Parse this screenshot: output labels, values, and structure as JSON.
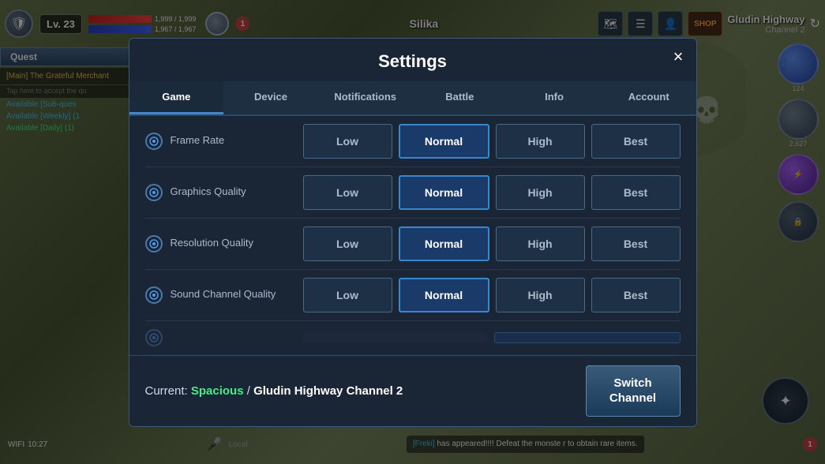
{
  "game": {
    "level": "Lv. 23",
    "hp": "1,999 / 1,999",
    "mp": "1,967 / 1,967",
    "player_name": "Silika",
    "location": "Gludin Highway",
    "channel": "Channel 2",
    "shield_icon": "🛡",
    "orbs": [
      {
        "label": "124",
        "type": "blue"
      },
      {
        "label": "2,627",
        "type": "gray"
      },
      {
        "label": "",
        "type": "purple"
      },
      {
        "label": "",
        "type": "dark"
      }
    ]
  },
  "quest_panel": {
    "quest_btn_label": "Quest",
    "items": [
      {
        "text": "[Main] The Grateful Merchant",
        "color": "gold"
      },
      {
        "text": "Tap here to accept the qu",
        "color": "gray"
      },
      {
        "text": "Available [Sub-ques",
        "color": "cyan"
      },
      {
        "text": "Available [Weekly] (1",
        "color": "cyan"
      },
      {
        "text": "Available [Daily] (1)",
        "color": "green"
      }
    ]
  },
  "bottom": {
    "wifi_label": "WIFI",
    "time": "10:27",
    "chat_speaker": "[Freki]",
    "chat_msg": " has appeared!!!! Defeat the monste\nr to obtain rare items.",
    "local_label": "Local",
    "badge_num": "1"
  },
  "settings": {
    "title": "Settings",
    "close_label": "×",
    "tabs": [
      {
        "id": "game",
        "label": "Game",
        "active": true
      },
      {
        "id": "device",
        "label": "Device",
        "active": false
      },
      {
        "id": "notifications",
        "label": "Notifications",
        "active": false
      },
      {
        "id": "battle",
        "label": "Battle",
        "active": false
      },
      {
        "id": "info",
        "label": "Info",
        "active": false
      },
      {
        "id": "account",
        "label": "Account",
        "active": false
      }
    ],
    "rows": [
      {
        "id": "frame-rate",
        "label": "Frame Rate",
        "options": [
          "Low",
          "Normal",
          "High",
          "Best"
        ],
        "selected": "Normal"
      },
      {
        "id": "graphics-quality",
        "label": "Graphics Quality",
        "options": [
          "Low",
          "Normal",
          "High",
          "Best"
        ],
        "selected": "Normal"
      },
      {
        "id": "resolution-quality",
        "label": "Resolution Quality",
        "options": [
          "Low",
          "Normal",
          "High",
          "Best"
        ],
        "selected": "Normal"
      },
      {
        "id": "sound-channel-quality",
        "label": "Sound Channel Quality",
        "options": [
          "Low",
          "Normal",
          "High",
          "Best"
        ],
        "selected": "Normal"
      }
    ],
    "footer": {
      "current_label": "Current:",
      "spacious_label": "Spacious",
      "separator": " / ",
      "channel_label": "Gludin Highway Channel 2",
      "switch_label": "Switch\nChannel"
    }
  }
}
